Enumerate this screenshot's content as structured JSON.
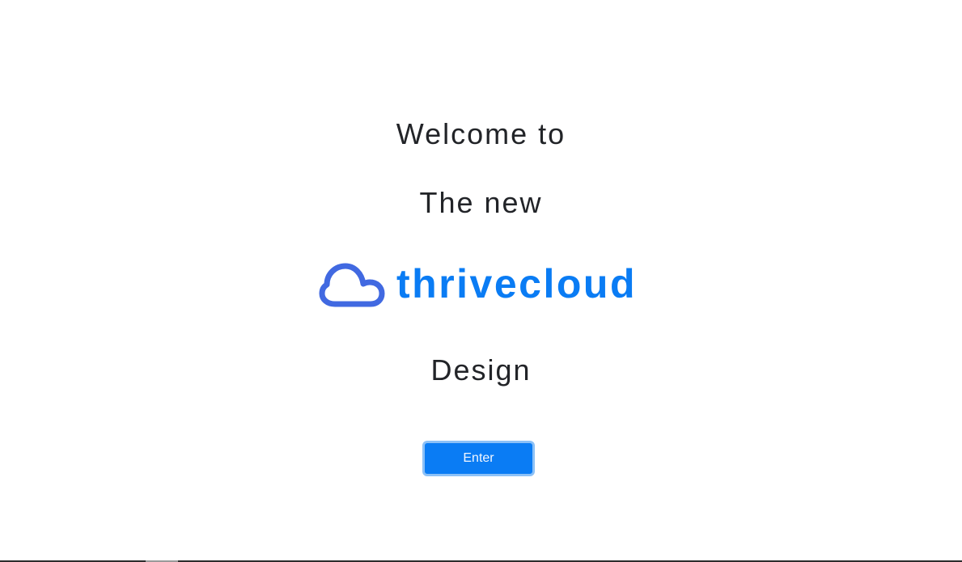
{
  "welcome": {
    "line1": "Welcome to",
    "line2": "The new",
    "brand": {
      "name": "thrivecloud",
      "icon": "cloud-icon",
      "color": "#0a7cf4",
      "icon_color": "#4169e1"
    },
    "line3": "Design"
  },
  "actions": {
    "enter_label": "Enter",
    "button_color": "#0a7cf4"
  }
}
